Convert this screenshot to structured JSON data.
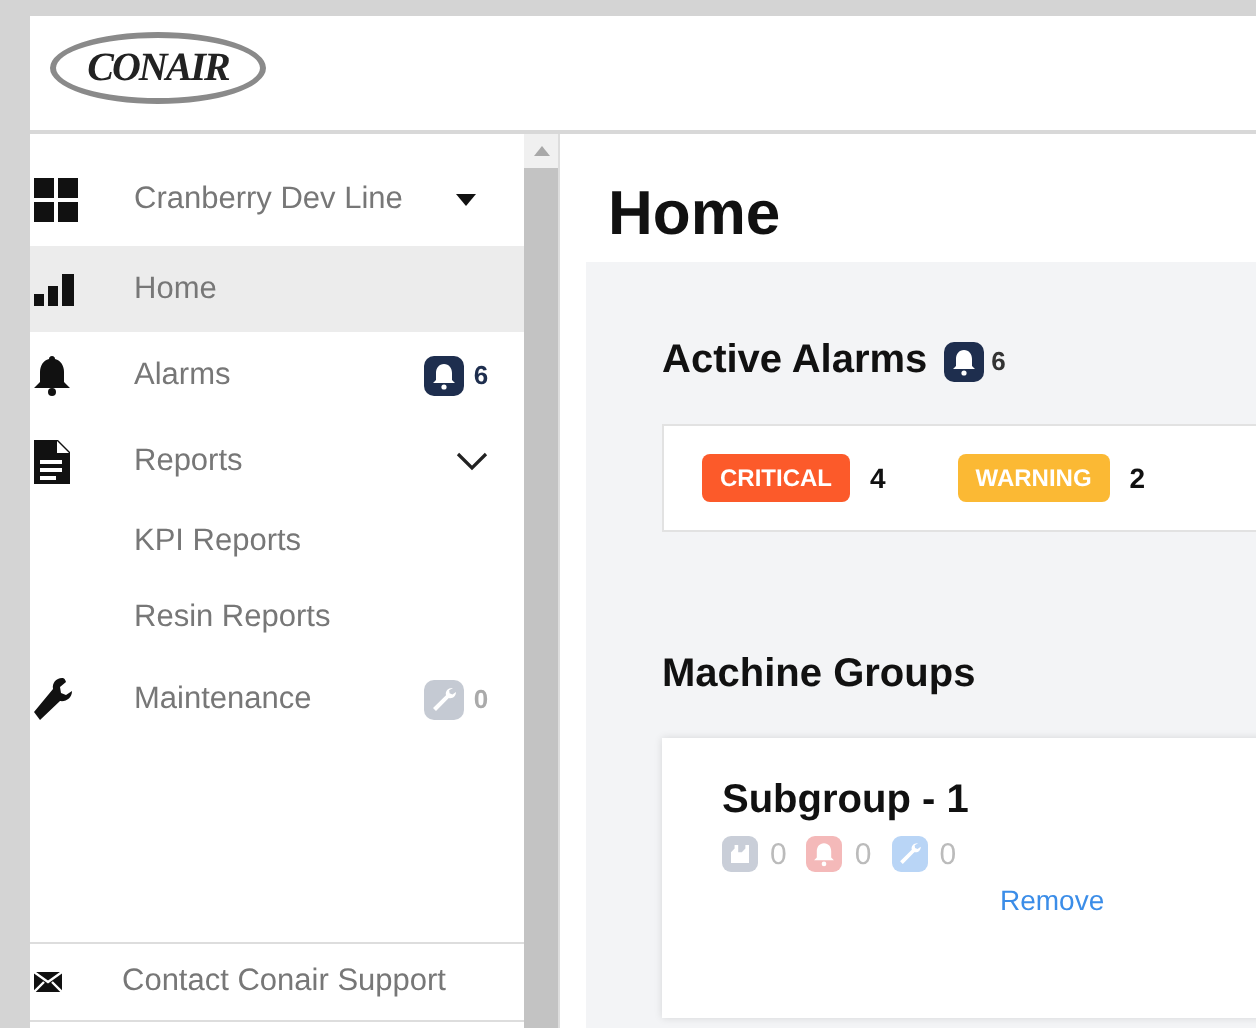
{
  "header": {
    "logo": "CONAIR"
  },
  "sidebar": {
    "line_selector": {
      "label": "Cranberry Dev Line"
    },
    "items": [
      {
        "label": "Home",
        "selected": true
      },
      {
        "label": "Alarms",
        "selected": false,
        "badge": {
          "kind": "alarm",
          "count": "6",
          "color": "#1e2e4e"
        }
      },
      {
        "label": "Reports",
        "selected": false,
        "expanded": true,
        "children": [
          {
            "label": "KPI Reports",
            "selected": false
          },
          {
            "label": "Resin Reports",
            "selected": false
          }
        ]
      },
      {
        "label": "Maintenance",
        "selected": false,
        "badge": {
          "kind": "maintenance",
          "count": "0",
          "color": "#c5cad3"
        }
      }
    ],
    "footer": {
      "label": "Contact Conair Support"
    }
  },
  "main": {
    "title": "Home",
    "active_alarms": {
      "title": "Active Alarms",
      "badge": {
        "kind": "alarm",
        "count": "6",
        "color": "#1e2e4e"
      },
      "levels": [
        {
          "label": "CRITICAL",
          "count": "4",
          "color": "#fc5a2a"
        },
        {
          "label": "WARNING",
          "count": "2",
          "color": "#fbb934"
        }
      ]
    },
    "machine_groups": {
      "title": "Machine Groups",
      "groups": [
        {
          "name": "Subgroup - 1",
          "stats": [
            {
              "kind": "machines",
              "count": "0",
              "color": "#c9ced8"
            },
            {
              "kind": "alarm",
              "count": "0",
              "color": "#f4b9b9"
            },
            {
              "kind": "maintenance",
              "count": "0",
              "color": "#b9d5f6"
            }
          ],
          "action": "Remove"
        }
      ]
    }
  }
}
